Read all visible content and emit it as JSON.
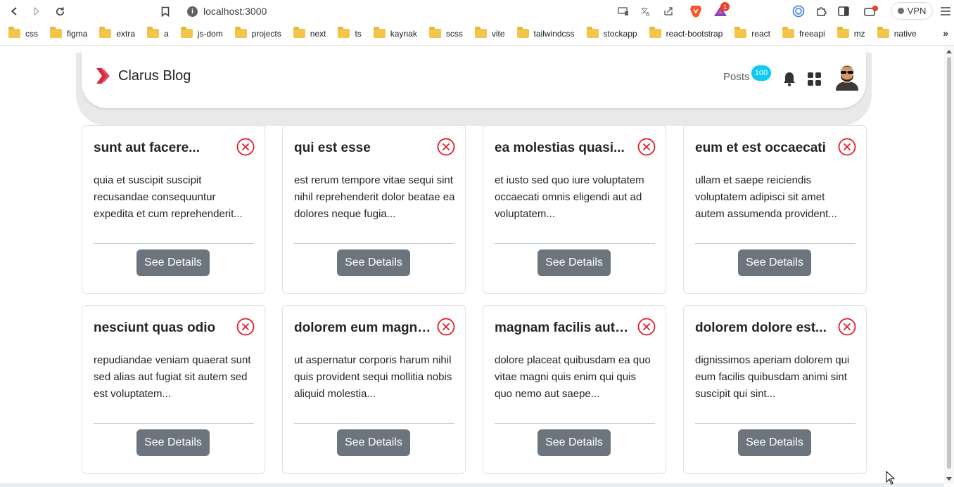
{
  "browser": {
    "url": "localhost:3000",
    "vpn_label": "VPN",
    "extension_badge": "1",
    "bookmarks": [
      "css",
      "figma",
      "extra",
      "a",
      "js-dom",
      "projects",
      "next",
      "ts",
      "kaynak",
      "scss",
      "vite",
      "tailwindcss",
      "stockapp",
      "react-bootstrap",
      "react",
      "freeapi",
      "mz",
      "native"
    ],
    "more_bookmarks": "»"
  },
  "navbar": {
    "brand": "Clarus Blog",
    "posts_label": "Posts",
    "posts_count": "100"
  },
  "colors": {
    "brand_red": "#d6293f",
    "badge": "#0dcaf0",
    "button": "#6c757d",
    "close_red": "#e11d2b"
  },
  "cards": [
    {
      "title": "sunt aut facere...",
      "body": "quia et suscipit suscipit recusandae consequuntur expedita et cum reprehenderit...",
      "button": "See Details"
    },
    {
      "title": "qui est esse",
      "body": "est rerum tempore vitae sequi sint nihil reprehenderit dolor beatae ea dolores neque fugia...",
      "button": "See Details"
    },
    {
      "title": "ea molestias quasi...",
      "body": "et iusto sed quo iure voluptatem occaecati omnis eligendi aut ad voluptatem...",
      "button": "See Details"
    },
    {
      "title": "eum et est occaecati",
      "body": "ullam et saepe reiciendis voluptatem adipisci sit amet autem assumenda provident...",
      "button": "See Details"
    },
    {
      "title": "nesciunt quas odio",
      "body": "repudiandae veniam quaerat sunt sed alias aut fugiat sit autem sed est voluptatem...",
      "button": "See Details"
    },
    {
      "title": "dolorem eum magni...",
      "body": "ut aspernatur corporis harum nihil quis provident sequi mollitia nobis aliquid molestia...",
      "button": "See Details"
    },
    {
      "title": "magnam facilis autem",
      "body": "dolore placeat quibusdam ea quo vitae magni quis enim qui quis quo nemo aut saepe...",
      "button": "See Details"
    },
    {
      "title": "dolorem dolore est...",
      "body": "dignissimos aperiam dolorem qui eum facilis quibusdam animi sint suscipit qui sint...",
      "button": "See Details"
    }
  ]
}
